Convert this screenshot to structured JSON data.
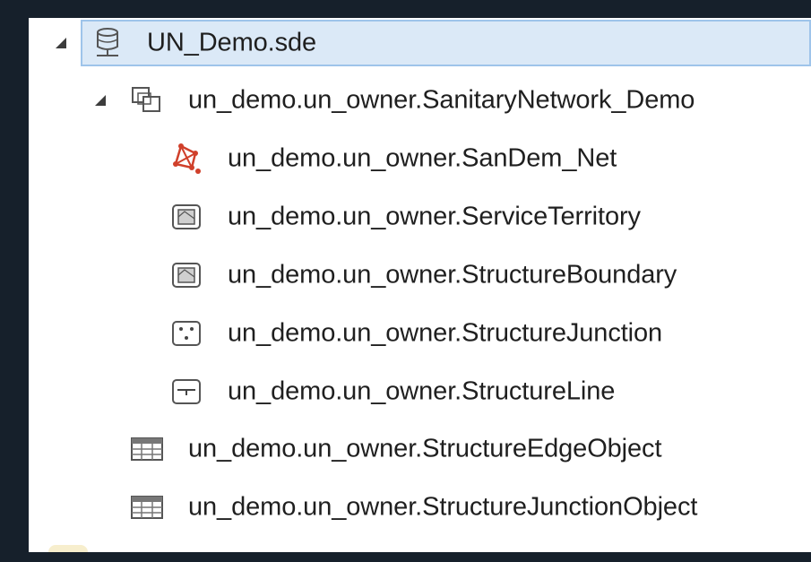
{
  "tree": {
    "root": {
      "label": "UN_Demo.sde",
      "icon": "database-connection-icon",
      "expanded": true,
      "selected": true
    },
    "dataset": {
      "label": "un_demo.un_owner.SanitaryNetwork_Demo",
      "icon": "feature-dataset-icon",
      "expanded": true,
      "children": [
        {
          "label": "un_demo.un_owner.SanDem_Net",
          "icon": "utility-network-icon"
        },
        {
          "label": "un_demo.un_owner.ServiceTerritory",
          "icon": "polygon-feature-class-icon"
        },
        {
          "label": "un_demo.un_owner.StructureBoundary",
          "icon": "polygon-feature-class-icon"
        },
        {
          "label": "un_demo.un_owner.StructureJunction",
          "icon": "point-feature-class-icon"
        },
        {
          "label": "un_demo.un_owner.StructureLine",
          "icon": "line-feature-class-icon"
        }
      ]
    },
    "tables": [
      {
        "label": "un_demo.un_owner.StructureEdgeObject",
        "icon": "table-icon"
      },
      {
        "label": "un_demo.un_owner.StructureJunctionObject",
        "icon": "table-icon"
      }
    ]
  },
  "colors": {
    "selection_fill": "#dbe9f7",
    "selection_border": "#9ec4ea",
    "network_icon": "#d0402b",
    "frame": "#16202b"
  }
}
